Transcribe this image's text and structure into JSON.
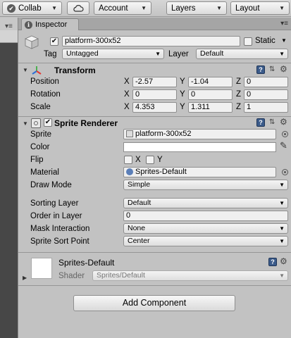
{
  "toolbar": {
    "collab_label": "Collab",
    "account_label": "Account",
    "layers_label": "Layers",
    "layout_label": "Layout"
  },
  "inspector": {
    "tab_label": "Inspector",
    "object": {
      "enabled": true,
      "name": "platform-300x52",
      "static_label": "Static",
      "tag_label": "Tag",
      "tag_value": "Untagged",
      "layer_label": "Layer",
      "layer_value": "Default"
    },
    "transform": {
      "title": "Transform",
      "axis_x": "X",
      "axis_y": "Y",
      "axis_z": "Z",
      "position_label": "Position",
      "position": {
        "x": "-2.57",
        "y": "-1.04",
        "z": "0"
      },
      "rotation_label": "Rotation",
      "rotation": {
        "x": "0",
        "y": "0",
        "z": "0"
      },
      "scale_label": "Scale",
      "scale": {
        "x": "4.353",
        "y": "1.311",
        "z": "1"
      }
    },
    "sprite_renderer": {
      "title": "Sprite Renderer",
      "enabled": true,
      "sprite_label": "Sprite",
      "sprite_value": "platform-300x52",
      "color_label": "Color",
      "color_value": "#ffffff",
      "flip_label": "Flip",
      "flip_x_label": "X",
      "flip_y_label": "Y",
      "material_label": "Material",
      "material_value": "Sprites-Default",
      "draw_mode_label": "Draw Mode",
      "draw_mode_value": "Simple",
      "sorting_layer_label": "Sorting Layer",
      "sorting_layer_value": "Default",
      "order_in_layer_label": "Order in Layer",
      "order_in_layer_value": "0",
      "mask_interaction_label": "Mask Interaction",
      "mask_interaction_value": "None",
      "sprite_sort_point_label": "Sprite Sort Point",
      "sprite_sort_point_value": "Center"
    },
    "material_section": {
      "name": "Sprites-Default",
      "shader_label": "Shader",
      "shader_value": "Sprites/Default"
    },
    "add_component_label": "Add Component"
  }
}
